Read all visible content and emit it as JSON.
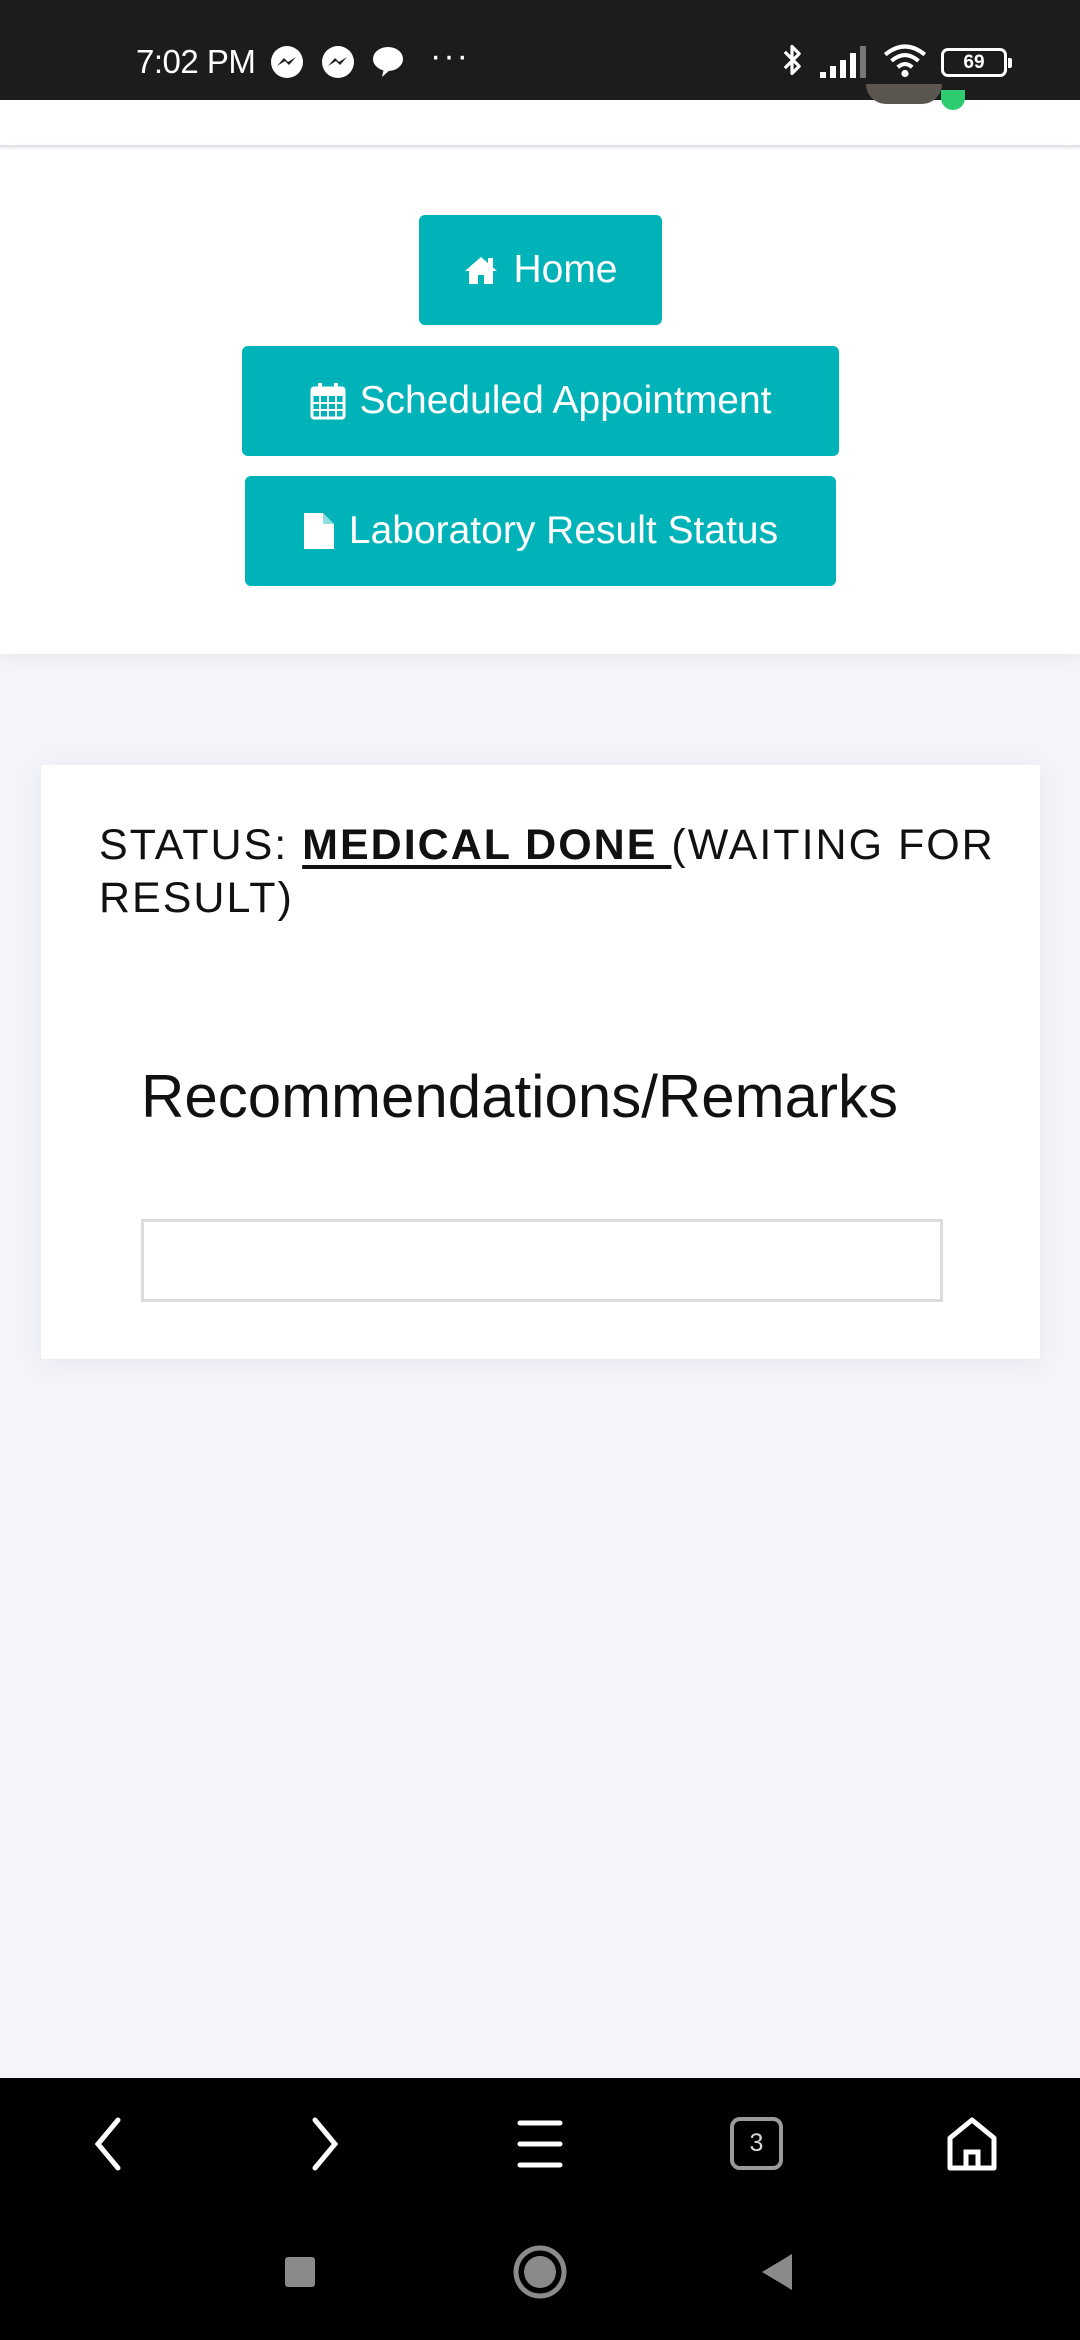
{
  "status_bar": {
    "time": "7:02 PM",
    "notifications": [
      "messenger-icon",
      "messenger-icon",
      "chat-bubble-icon",
      "more-dots-icon"
    ],
    "more": "···",
    "battery": "69"
  },
  "nav": {
    "home": "Home",
    "scheduled": "Scheduled Appointment",
    "lab": "Laboratory Result Status"
  },
  "card": {
    "status_prefix": "STATUS: ",
    "status_value": "MEDICAL DONE ",
    "status_suffix": "(WAITING FOR RESULT)",
    "remarks_label": "Recommendations/Remarks",
    "remarks_value": ""
  },
  "browser": {
    "tabs_count": "3"
  },
  "colors": {
    "accent": "#00b3b9",
    "page_bg": "#f4f5fa",
    "online": "#2ecc71"
  }
}
